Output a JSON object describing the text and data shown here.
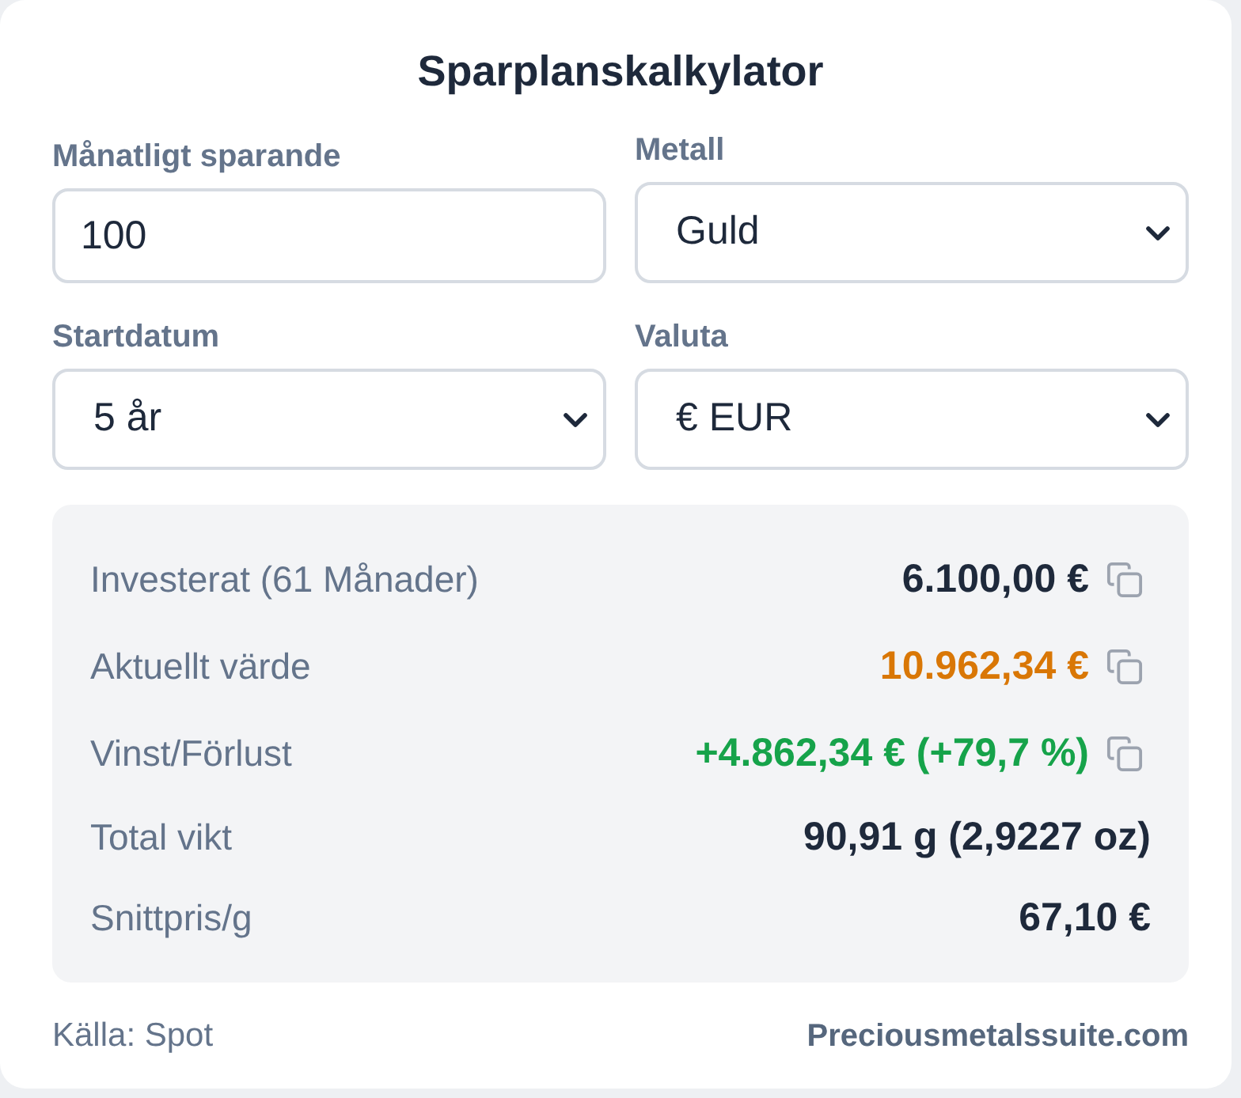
{
  "title": "Sparplanskalkylator",
  "fields": [
    {
      "kind": "input",
      "label": "Månatligt sparande",
      "value": "100"
    },
    {
      "kind": "select",
      "label": "Metall",
      "value": "Guld"
    },
    {
      "kind": "select",
      "label": "Startdatum",
      "value": "5 år"
    },
    {
      "kind": "select",
      "label": "Valuta",
      "value": "€ EUR"
    }
  ],
  "results": [
    {
      "label": "Investerat (61 Månader)",
      "value": "6.100,00 €",
      "color": "#1e293b",
      "copyable": true
    },
    {
      "label": "Aktuellt värde",
      "value": "10.962,34 €",
      "color": "#d97706",
      "copyable": true
    },
    {
      "label": "Vinst/Förlust",
      "value": "+4.862,34 € (+79,7 %)",
      "color": "#16a34a",
      "copyable": true
    },
    {
      "label": "Total vikt",
      "value": "90,91 g (2,9227 oz)",
      "color": "#1e293b",
      "copyable": false
    },
    {
      "label": "Snittpris/g",
      "value": "67,10 €",
      "color": "#1e293b",
      "copyable": false
    }
  ],
  "footer": {
    "source": "Källa: Spot",
    "brand": "Preciousmetalssuite.com"
  }
}
